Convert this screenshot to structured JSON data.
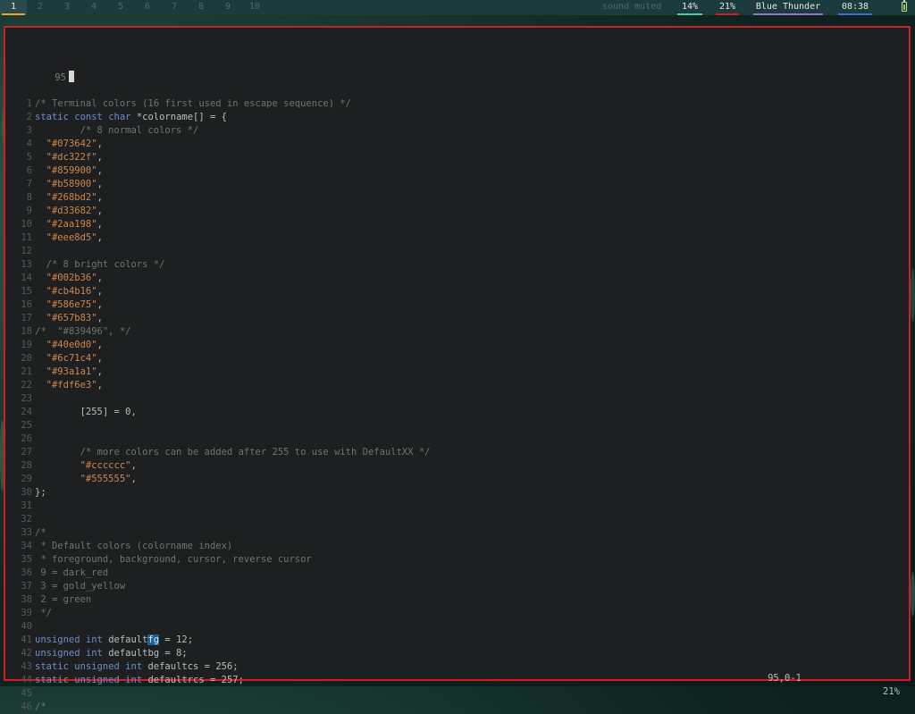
{
  "topbar": {
    "workspaces": [
      "1",
      "2",
      "3",
      "4",
      "5",
      "6",
      "7",
      "8",
      "9",
      "10"
    ],
    "active_workspace": "1",
    "sound": "sound muted",
    "cpu": "14%",
    "mem": "21%",
    "network": "Blue Thunder",
    "clock": "08:38",
    "colors": {
      "cpu": "#4ec9b0",
      "mem": "#d01f22",
      "network": "#9a6fd0",
      "clock": "#3a6fd0",
      "active_ws": "#f0a030"
    },
    "battery_icon": "battery-icon"
  },
  "editor": {
    "cursor_line_number": "95",
    "lines": [
      {
        "n": "1",
        "text": "/* Terminal colors (16 first used in escape sequence) */"
      },
      {
        "n": "2",
        "text": "static const char *colorname[] = {"
      },
      {
        "n": "3",
        "text": "        /* 8 normal colors */"
      },
      {
        "n": "4",
        "text": "  \"#073642\","
      },
      {
        "n": "5",
        "text": "  \"#dc322f\","
      },
      {
        "n": "6",
        "text": "  \"#859900\","
      },
      {
        "n": "7",
        "text": "  \"#b58900\","
      },
      {
        "n": "8",
        "text": "  \"#268bd2\","
      },
      {
        "n": "9",
        "text": "  \"#d33682\","
      },
      {
        "n": "10",
        "text": "  \"#2aa198\","
      },
      {
        "n": "11",
        "text": "  \"#eee8d5\","
      },
      {
        "n": "12",
        "text": ""
      },
      {
        "n": "13",
        "text": "  /* 8 bright colors */"
      },
      {
        "n": "14",
        "text": "  \"#002b36\","
      },
      {
        "n": "15",
        "text": "  \"#cb4b16\","
      },
      {
        "n": "16",
        "text": "  \"#586e75\","
      },
      {
        "n": "17",
        "text": "  \"#657b83\","
      },
      {
        "n": "18",
        "text": "/*  \"#839496\", */"
      },
      {
        "n": "19",
        "text": "  \"#40e0d0\","
      },
      {
        "n": "20",
        "text": "  \"#6c71c4\","
      },
      {
        "n": "21",
        "text": "  \"#93a1a1\","
      },
      {
        "n": "22",
        "text": "  \"#fdf6e3\","
      },
      {
        "n": "23",
        "text": ""
      },
      {
        "n": "24",
        "text": "        [255] = 0,"
      },
      {
        "n": "25",
        "text": ""
      },
      {
        "n": "26",
        "text": ""
      },
      {
        "n": "27",
        "text": "        /* more colors can be added after 255 to use with DefaultXX */"
      },
      {
        "n": "28",
        "text": "        \"#cccccc\","
      },
      {
        "n": "29",
        "text": "        \"#555555\","
      },
      {
        "n": "30",
        "text": "};"
      },
      {
        "n": "31",
        "text": ""
      },
      {
        "n": "32",
        "text": ""
      },
      {
        "n": "33",
        "text": "/*"
      },
      {
        "n": "34",
        "text": " * Default colors (colorname index)"
      },
      {
        "n": "35",
        "text": " * foreground, background, cursor, reverse cursor"
      },
      {
        "n": "36",
        "text": " 9 = dark_red"
      },
      {
        "n": "37",
        "text": " 3 = gold_yellow"
      },
      {
        "n": "38",
        "text": " 2 = green"
      },
      {
        "n": "39",
        "text": " */"
      },
      {
        "n": "40",
        "text": ""
      },
      {
        "n": "41",
        "text": "unsigned int defaultfg = 12;"
      },
      {
        "n": "42",
        "text": "unsigned int defaultbg = 8;"
      },
      {
        "n": "43",
        "text": "static unsigned int defaultcs = 256;"
      },
      {
        "n": "44",
        "text": "static unsigned int defaultrcs = 257;"
      },
      {
        "n": "45",
        "text": ""
      },
      {
        "n": "46",
        "text": "/*"
      }
    ],
    "highlighted_word": "fg",
    "status_position": "95,0-1",
    "status_percent": "21%",
    "border_color": "#d01f22"
  }
}
